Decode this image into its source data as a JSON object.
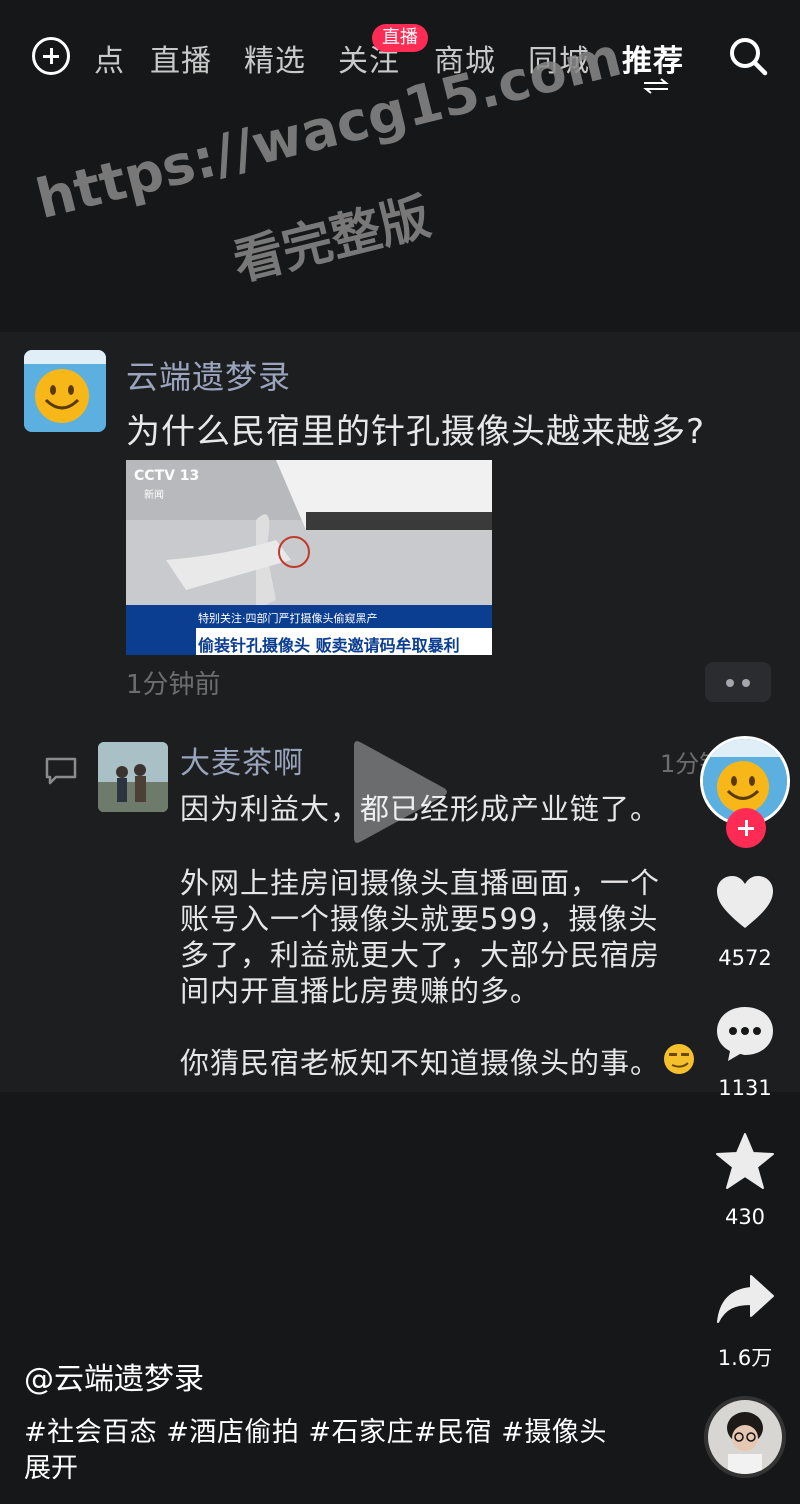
{
  "top_nav": {
    "tabs": [
      "点",
      "直播",
      "精选",
      "关注",
      "商城",
      "同城",
      "推荐"
    ],
    "active_tab": "推荐",
    "live_badge": "直播"
  },
  "watermark": {
    "line1": "https://wacg15.com",
    "line2": "看完整版"
  },
  "post": {
    "author": "云端遗梦录",
    "question": "为什么民宿里的针孔摄像头越来越多?",
    "image_caption_top": "特别关注·四部门严打摄像头偷窥黑产",
    "image_caption_main": "偷装针孔摄像头 贩卖邀请码牟取暴利",
    "image_logo": "CCTV 13",
    "image_logo_sub": "新闻",
    "time": "1分钟前"
  },
  "reply": {
    "author": "大麦茶啊",
    "time": "1分钟",
    "lines": [
      "因为利益大，都已经形成产业链了。",
      "外网上挂房间摄像头直播画面，一个",
      "账号入一个摄像头就要599，摄像头",
      "多了，利益就更大了，大部分民宿房",
      "间内开直播比房费赚的多。",
      "你猜民宿老板知不知道摄像头的事。"
    ]
  },
  "rail": {
    "likes": "4572",
    "comments": "1131",
    "favorites": "430",
    "shares": "1.6万"
  },
  "bottom": {
    "author": "@云端遗梦录",
    "tags": "#社会百态 #酒店偷拍 #石家庄#民宿 #摄像头",
    "expand": "展开"
  },
  "colors": {
    "background": "#161718",
    "card": "#1d1e20",
    "accent_red": "#fe2c55",
    "name_blue": "#9aa4bd"
  }
}
